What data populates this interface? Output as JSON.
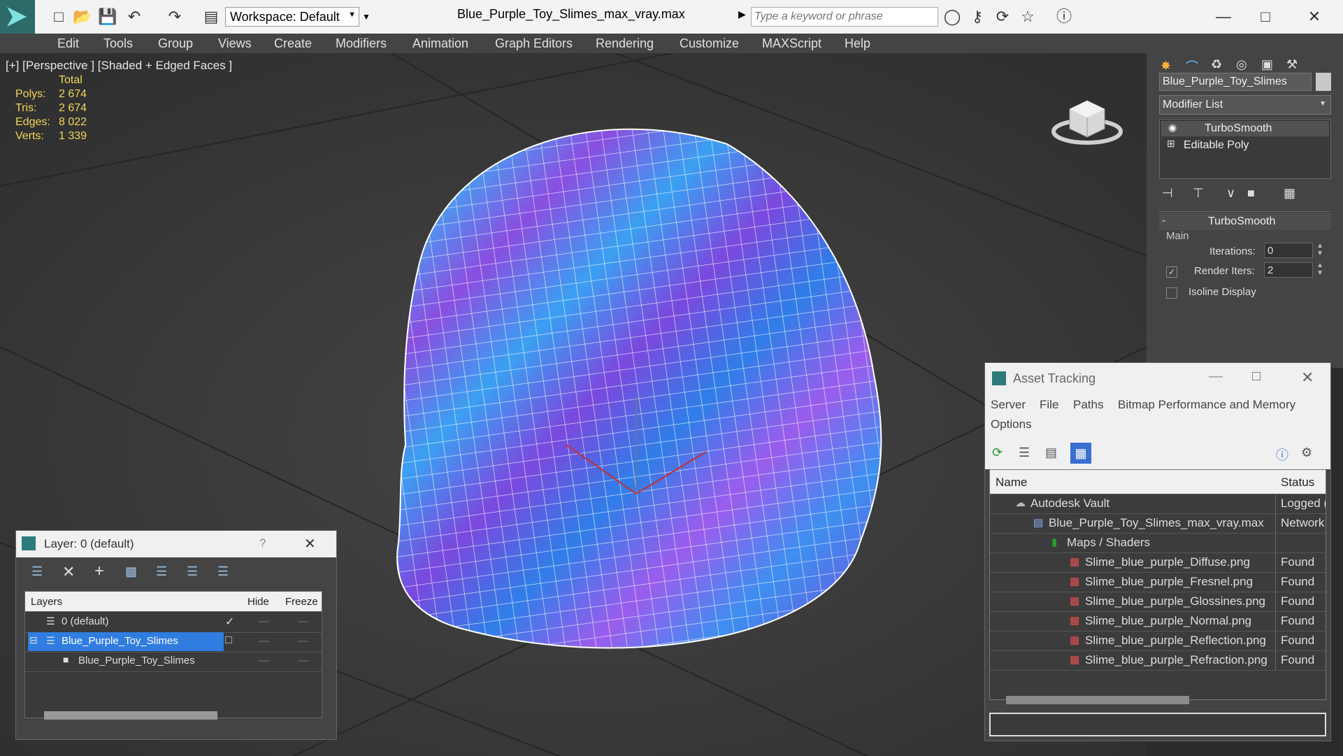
{
  "titlebar": {
    "workspace_label": "Workspace: Default",
    "filename": "Blue_Purple_Toy_Slimes_max_vray.max",
    "search_placeholder": "Type a keyword or phrase"
  },
  "menu": [
    "Edit",
    "Tools",
    "Group",
    "Views",
    "Create",
    "Modifiers",
    "Animation",
    "Graph Editors",
    "Rendering",
    "Customize",
    "MAXScript",
    "Help"
  ],
  "viewport": {
    "label": "[+] [Perspective ] [Shaded + Edged Faces ]",
    "stats_header": "Total",
    "stats": [
      {
        "label": "Polys:",
        "value": "2 674"
      },
      {
        "label": "Tris:",
        "value": "2 674"
      },
      {
        "label": "Edges:",
        "value": "8 022"
      },
      {
        "label": "Verts:",
        "value": "1 339"
      }
    ]
  },
  "command_panel": {
    "object_name": "Blue_Purple_Toy_Slimes",
    "modifier_list_label": "Modifier List",
    "stack": [
      "TurboSmooth",
      "Editable Poly"
    ],
    "rollout_title": "TurboSmooth",
    "group_main": "Main",
    "iterations_label": "Iterations:",
    "iterations_value": "0",
    "render_iters_label": "Render Iters:",
    "render_iters_value": "2",
    "isoline_label": "Isoline Display"
  },
  "layer_window": {
    "title": "Layer: 0 (default)",
    "help": "?",
    "col_layers": "Layers",
    "col_hide": "Hide",
    "col_freeze": "Freeze",
    "rows": [
      "0 (default)",
      "Blue_Purple_Toy_Slimes",
      "Blue_Purple_Toy_Slimes"
    ]
  },
  "asset_window": {
    "title": "Asset Tracking",
    "menu": [
      "Server",
      "File",
      "Paths",
      "Bitmap Performance and Memory"
    ],
    "menu2": "Options",
    "col_name": "Name",
    "col_status": "Status",
    "rows": [
      {
        "name": "Autodesk Vault",
        "status": "Logged (",
        "indent": 0
      },
      {
        "name": "Blue_Purple_Toy_Slimes_max_vray.max",
        "status": "Network",
        "indent": 1
      },
      {
        "name": "Maps / Shaders",
        "status": "",
        "indent": 2
      },
      {
        "name": "Slime_blue_purple_Diffuse.png",
        "status": "Found",
        "indent": 3
      },
      {
        "name": "Slime_blue_purple_Fresnel.png",
        "status": "Found",
        "indent": 3
      },
      {
        "name": "Slime_blue_purple_Glossines.png",
        "status": "Found",
        "indent": 3
      },
      {
        "name": "Slime_blue_purple_Normal.png",
        "status": "Found",
        "indent": 3
      },
      {
        "name": "Slime_blue_purple_Reflection.png",
        "status": "Found",
        "indent": 3
      },
      {
        "name": "Slime_blue_purple_Refraction.png",
        "status": "Found",
        "indent": 3
      }
    ]
  },
  "colors": {
    "accent": "#3a7bd5",
    "stats_yellow": "#f0d75a",
    "selection": "#2f7de1"
  }
}
